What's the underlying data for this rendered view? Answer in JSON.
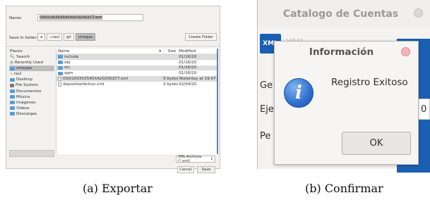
{
  "exportar": {
    "name_label": "Name:",
    "name_value": "OSO100303595XA202002CT.xml",
    "save_in_label": "Save in folder:",
    "path": [
      "raul",
      "git",
      "omegas"
    ],
    "create_folder": "Create Folder",
    "places_header": "Places",
    "places": [
      {
        "label": "Search",
        "icon": "search-icon"
      },
      {
        "label": "Recently Used",
        "icon": "clock-icon"
      },
      {
        "label": "omegas",
        "icon": "folder-icon",
        "active": true
      },
      {
        "label": "raul",
        "icon": "home-icon"
      },
      {
        "label": "Desktop",
        "icon": "folder-icon"
      },
      {
        "label": "File System",
        "icon": "drive-icon"
      },
      {
        "label": "Documentos",
        "icon": "folder-icon"
      },
      {
        "label": "Música",
        "icon": "folder-icon"
      },
      {
        "label": "Imágenes",
        "icon": "folder-icon"
      },
      {
        "label": "Vídeos",
        "icon": "folder-icon"
      },
      {
        "label": "Descargas",
        "icon": "folder-icon"
      }
    ],
    "columns": {
      "name": "Name",
      "size": "Size",
      "modified": "Modified"
    },
    "files": [
      {
        "name": "include",
        "size": "",
        "modified": "01/16/20",
        "type": "folder"
      },
      {
        "name": "obj",
        "size": "",
        "modified": "01/16/20",
        "type": "folder"
      },
      {
        "name": "src",
        "size": "",
        "modified": "01/16/20",
        "type": "folder"
      },
      {
        "name": "xpm",
        "size": "",
        "modified": "01/16/20",
        "type": "folder"
      },
      {
        "name": "OSO100303595XA202002CT.xml",
        "size": "0 bytes",
        "modified": "Yesterday at 19:07",
        "type": "file"
      },
      {
        "name": "depositoefectivo.xml",
        "size": "0 bytes",
        "modified": "02/04/20",
        "type": "file"
      }
    ],
    "filter": "XML-Archivos (*.xml)",
    "cancel": "Cancel",
    "save": "Save"
  },
  "confirmar": {
    "window_title": "Catalogo de Cuentas",
    "xml_icon_text": "XML",
    "xml_label": "XML",
    "bg_labels": [
      "Ge",
      "Eje",
      "Pe"
    ],
    "bg_value": "0",
    "dialog_title": "Información",
    "message": "Registro Exitoso",
    "ok": "OK"
  },
  "captions": {
    "a": "(a) Exportar",
    "b": "(b) Confirmar"
  }
}
